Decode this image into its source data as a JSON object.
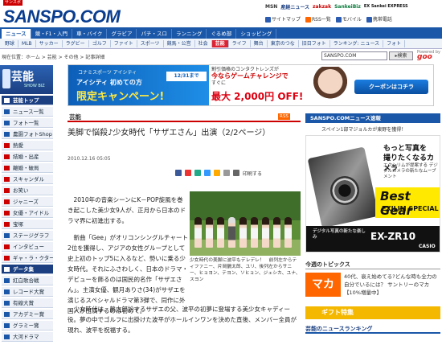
{
  "header": {
    "logo": "SANSPO.COM",
    "logo_tag": "サンスポ",
    "partners": [
      "MSN",
      "産経ニュース",
      "zakzak",
      "SankeiBiz",
      "EX Sankei EXPRESS"
    ],
    "utility": [
      "サイトマップ",
      "RSS一覧",
      "モバイル",
      "携帯電話"
    ]
  },
  "nav1": {
    "tabs": [
      "ニュース",
      "競・F1・入門",
      "車・バイク",
      "グラビア",
      "パチ・スロ",
      "ランニング",
      "ぐるめ部",
      "ショッピング"
    ],
    "active": 0
  },
  "nav2": {
    "tabs": [
      "野球",
      "MLB",
      "サッカー",
      "ラグビー",
      "ゴルフ",
      "ファイト",
      "スポーツ",
      "競馬・公営",
      "社会",
      "芸能",
      "ライフ",
      "舞台",
      "東京のつな",
      "旧日フォト",
      "ランキング: ニュース",
      "フォト"
    ],
    "active": 9
  },
  "breadcrumb": "現在位置：ホーム > 芸能 > その他 > 記事詳細",
  "search": {
    "value": "SANSPO.COM",
    "button": "検索",
    "powered": "Powered by",
    "engine": "goo"
  },
  "sidebar": {
    "title": "芸能",
    "subtitle": "SHOW BIZ",
    "items": [
      "芸能トップ",
      "ニュース一覧",
      "フォト一覧",
      "農園フォトShop",
      "熱愛",
      "結婚・出産",
      "離婚・破局",
      "スキャンダル",
      "お笑い",
      "ジャニーズ",
      "女優・アイドル",
      "宝塚",
      "ステージグラフ",
      "インタビュー",
      "ギャ・ラ・クター",
      "データ集",
      "紅白歌合戦",
      "レコード大賞",
      "有線大賞",
      "アカデミー賞",
      "グラミー賞",
      "大河ドラマ"
    ]
  },
  "banner": {
    "brand": "コナミスポーツ アイシティ",
    "line1": "アイシティ 初めての方",
    "line2": "限定キャンペーン!",
    "date": "12/31まで",
    "mid_head": "割引価格のコンタクトレンズが",
    "mid_line": "今ならゲームチャレンジで",
    "mid_price_label": "すぐに",
    "price": "最大 2,000円 OFF!",
    "coupon": "クーポンはコチラ"
  },
  "article": {
    "category": "芸能",
    "rss": "RSS",
    "title": "美脚で悩殺♪少女時代「サザエさん」出演（2/2ページ）",
    "date": "2010.12.16 05:05",
    "tools": [
      "印刷する"
    ],
    "body": [
      "2010年の音楽シーンにK－POP旋風を巻き起こした美少女9人が、正月から日本のドラマ界に初進出する。",
      "新曲「Gee」がオリコンシングルチャート2位を獲得し、アジアの女性グループとして史上初のトップ5に入るなど、勢いに乗る少女時代。それにふさわしく、日本のドラマ・デビューを飾るのは国民的名作「サザエさん」。主演女優、観月ありさ(34)がサザエを演じるスペシャルドラマ第3弾で、同作に外国人が出演するのは初めて。"
    ],
    "caption": "少女時代の美脚に波平もデレデレ！　前列左からティファニー、片岡鶴太郎、ユリ、後列左からサニー、ヒョヨン、テヨン、ソヒョン、ジェシカ、ユナ、スヨン",
    "body2": "少女時代は、鶴太郎扮するサザエの父、波平の初夢に登場する美少女キャディー役。夢の中でゴルフに出掛けた波平がホールインワンを決めた直後、メンバー全員が現れ、波平を祝福する。"
  },
  "right": {
    "news_head": "SANSPO.COMニュース速報",
    "ticker": "スペイン1部マジョルカが東野を獲得！",
    "ad": {
      "line1": "もっと写真を",
      "line2": "撮りたくなるカメラ",
      "text": "エクシリムが提案する デジタルカメラの新たなムーブメント",
      "bg1": "Best Gear",
      "bg2": "EXILIM SPECIAL",
      "b1": "デジタル写真の新たな楽しみ",
      "model": "EX-ZR10",
      "maker": "CASIO"
    },
    "topics_head": "今週のトピックス",
    "topic_img": "マカ",
    "topic_text": "40代、衰え始めてる?どんな時も全力の自分でいるには？ サントリーのマカ【10%増量中】",
    "gift": "ギフト特集",
    "rank": "芸能のニュースランキング"
  },
  "colors": {
    "brand": "#1b57a8",
    "accent": "#cc0000"
  }
}
